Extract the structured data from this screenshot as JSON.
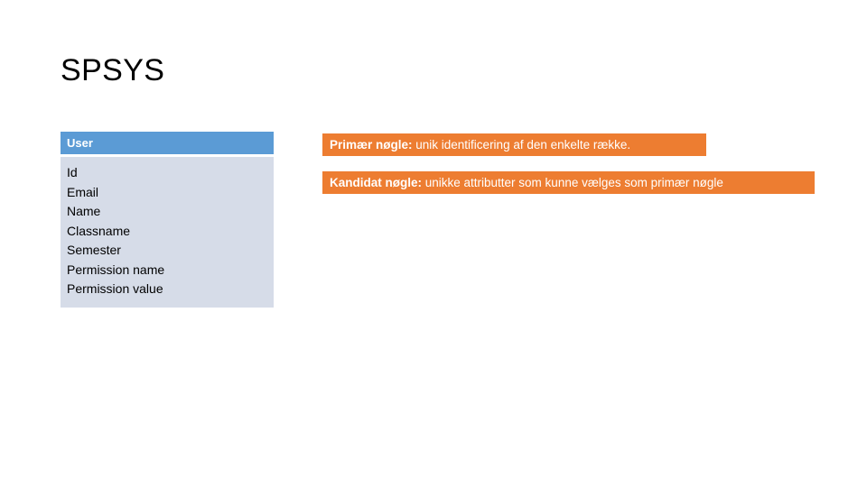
{
  "slide": {
    "title": "SPSYS",
    "background_color": "#FFFFFF"
  },
  "entity": {
    "name": "User",
    "header_color": "#5B9BD5",
    "body_color": "#D6DCE8",
    "fields": [
      {
        "label": "Id"
      },
      {
        "label": "Email"
      },
      {
        "label": "Name"
      },
      {
        "label": "Classname"
      },
      {
        "label": "Semester"
      },
      {
        "label": "Permission name"
      },
      {
        "label": "Permission value"
      }
    ]
  },
  "callouts": {
    "accent_color": "#ED7D31",
    "items": [
      {
        "lead": "Primær nøgle:",
        "rest": " unik identificering af den enkelte række."
      },
      {
        "lead": "Kandidat nøgle:",
        "rest": " unikke attributter som kunne vælges som primær nøgle"
      }
    ]
  }
}
